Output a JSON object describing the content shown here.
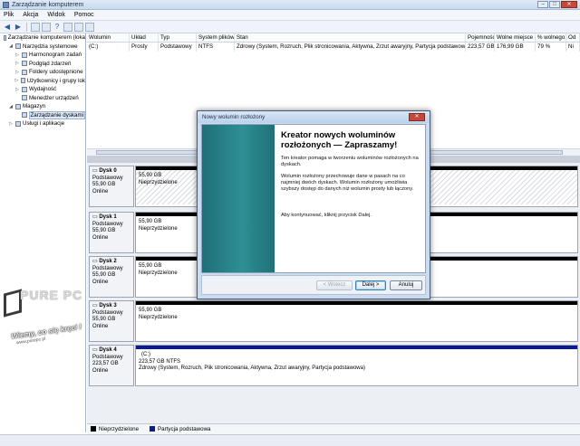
{
  "window": {
    "title": "Zarządzanie komputerem",
    "min": "–",
    "max": "□",
    "close": "✕"
  },
  "menu": [
    "Plik",
    "Akcja",
    "Widok",
    "Pomoc"
  ],
  "toolbar": [
    "arrow-left-icon",
    "arrow-right-icon",
    "folder-up-icon",
    "properties-icon",
    "help-icon",
    "refresh-icon",
    "options-icon",
    "export-icon"
  ],
  "tree": [
    {
      "label": "Zarządzanie komputerem (loka",
      "indent": 0,
      "expander": ""
    },
    {
      "label": "Narzędzia systemowe",
      "indent": 1,
      "expander": "◢"
    },
    {
      "label": "Harmonogram zadań",
      "indent": 2,
      "expander": "▷"
    },
    {
      "label": "Podgląd zdarzeń",
      "indent": 2,
      "expander": "▷"
    },
    {
      "label": "Foldery udostępnione",
      "indent": 2,
      "expander": "▷"
    },
    {
      "label": "Użytkownicy i grupy lok",
      "indent": 2,
      "expander": "▷"
    },
    {
      "label": "Wydajność",
      "indent": 2,
      "expander": "▷"
    },
    {
      "label": "Menedżer urządzeń",
      "indent": 2,
      "expander": ""
    },
    {
      "label": "Magazyn",
      "indent": 1,
      "expander": "◢"
    },
    {
      "label": "Zarządzanie dyskami",
      "indent": 2,
      "expander": "",
      "selected": true
    },
    {
      "label": "Usługi i aplikacje",
      "indent": 1,
      "expander": "▷"
    }
  ],
  "volume_list": {
    "columns": [
      "Wolumin",
      "Układ",
      "Typ",
      "System plików",
      "Stan",
      "Pojemność",
      "Wolne miejsce",
      "% wolnego",
      "Od"
    ],
    "rows": [
      [
        "(C:)",
        "Prosty",
        "Podstawowy",
        "NTFS",
        "Zdrowy (System, Rozruch, Plik stronicowania, Aktywna, Zrzut awaryjny, Partycja podstawowa)",
        "223,57 GB",
        "176,99 GB",
        "79 %",
        "Ni"
      ]
    ]
  },
  "disks": [
    {
      "name": "Dysk 0",
      "type": "Podstawowy",
      "size": "55,90 GB",
      "status": "Online",
      "vol_size": "55,90 GB",
      "vol_state": "Nieprzydzielone",
      "kind": "unallocated",
      "selected": true
    },
    {
      "name": "Dysk 1",
      "type": "Podstawowy",
      "size": "55,90 GB",
      "status": "Online",
      "vol_size": "55,90 GB",
      "vol_state": "Nieprzydzielone",
      "kind": "unallocated"
    },
    {
      "name": "Dysk 2",
      "type": "Podstawowy",
      "size": "55,90 GB",
      "status": "Online",
      "vol_size": "55,90 GB",
      "vol_state": "Nieprzydzielone",
      "kind": "unallocated"
    },
    {
      "name": "Dysk 3",
      "type": "Podstawowy",
      "size": "55,90 GB",
      "status": "Online",
      "vol_size": "55,90 GB",
      "vol_state": "Nieprzydzielone",
      "kind": "unallocated"
    },
    {
      "name": "Dysk 4",
      "type": "Podstawowy",
      "size": "223,57 GB",
      "status": "Online",
      "vol_name": "(C:)",
      "vol_size": "223,57 GB NTFS",
      "vol_state": "Zdrowy (System, Rozruch, Plik stronicowania, Aktywna, Zrzut awaryjny, Partycja podstawowa)",
      "kind": "primary"
    }
  ],
  "legend": [
    {
      "label": "Nieprzydzielone",
      "color": "#000000"
    },
    {
      "label": "Partycja podstawowa",
      "color": "#0a1d8a"
    }
  ],
  "watermark": {
    "logo": "PURE PC",
    "tagline": "Wiemy, co się kręci !",
    "url": "www.purepc.pl"
  },
  "dialog": {
    "title": "Nowy wolumin rozłożony",
    "close": "✕",
    "heading": "Kreator nowych woluminów rozłożonych — Zapraszamy!",
    "p1": "Ten kreator pomaga w tworzeniu woluminów rozłożonych na dyskach.",
    "p2": "Wolumin rozłożony przechowuje dane w pasach na co najmniej dwóch dyskach. Wolumin rozłożony umożliwia szybszy dostęp do danych niż wolumin prosty lub łączony.",
    "p3": "Aby kontynuować, kliknij przycisk Dalej.",
    "back": "< Wstecz",
    "next": "Dalej >",
    "cancel": "Anuluj",
    "side_color": "#2a8088"
  }
}
